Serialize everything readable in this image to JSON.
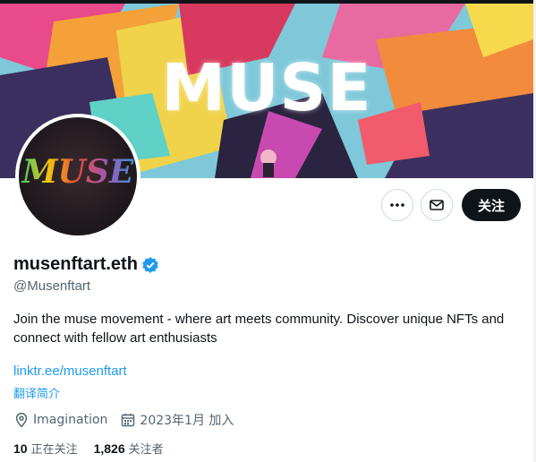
{
  "banner": {
    "title": "MUSE"
  },
  "avatar": {
    "text": "MUSE"
  },
  "actions": {
    "follow_label": "关注"
  },
  "profile": {
    "display_name": "musenftart.eth",
    "handle": "@Musenftart",
    "bio": "Join the muse movement - where art meets community. Discover unique NFTs and connect with fellow art enthusiasts",
    "link": "linktr.ee/musenftart",
    "translate_label": "翻译简介",
    "location": "Imagination",
    "joined": "2023年1月 加入"
  },
  "stats": {
    "following_count": "10",
    "following_label": "正在关注",
    "followers_count": "1,826",
    "followers_label": "关注者"
  },
  "icons": {
    "more": "more-dots-icon",
    "message": "envelope-icon",
    "verified": "verified-badge-icon",
    "location": "location-pin-icon",
    "calendar": "calendar-icon"
  },
  "colors": {
    "accent": "#1d9bf0",
    "text_primary": "#0f1419",
    "text_secondary": "#536471",
    "border": "#cfd9de"
  }
}
